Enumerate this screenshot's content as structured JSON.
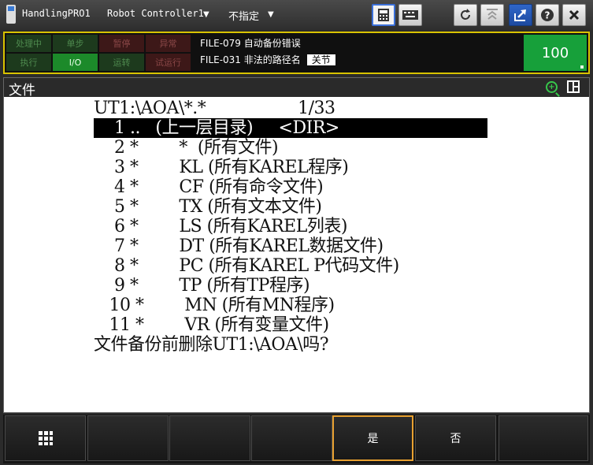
{
  "titlebar": {
    "program": "HandlingPRO1",
    "controller": "Robot Controller1",
    "group": "不指定"
  },
  "status": {
    "indicators": [
      "处理中",
      "单步",
      "暂停",
      "异常",
      "执行",
      "I/O",
      "运转",
      "试运行"
    ],
    "messages": [
      "FILE-079 自动备份错误",
      "FILE-031 非法的路径名"
    ],
    "message_key": "关节",
    "override": "100"
  },
  "panel": {
    "title": "文件",
    "lines": [
      {
        "text": "UT1:\\AOA\\*.*                  1/33",
        "selected": false
      },
      {
        "text": "    1 ..   (上一层目录)     <DIR>    ",
        "selected": true
      },
      {
        "text": "    2 *        *  (所有文件)",
        "selected": false
      },
      {
        "text": "    3 *        KL (所有KAREL程序)",
        "selected": false
      },
      {
        "text": "    4 *        CF (所有命令文件)",
        "selected": false
      },
      {
        "text": "    5 *        TX (所有文本文件)",
        "selected": false
      },
      {
        "text": "    6 *        LS (所有KAREL列表)",
        "selected": false
      },
      {
        "text": "    7 *        DT (所有KAREL数据文件)",
        "selected": false
      },
      {
        "text": "    8 *        PC (所有KAREL P代码文件)",
        "selected": false
      },
      {
        "text": "    9 *        TP (所有TP程序)",
        "selected": false
      },
      {
        "text": "   10 *        MN (所有MN程序)",
        "selected": false
      },
      {
        "text": "   11 *        VR (所有变量文件)",
        "selected": false
      },
      {
        "text": "文件备份前删除UT1:\\AOA\\吗?",
        "selected": false
      }
    ]
  },
  "softkeys": [
    "",
    "",
    "",
    "",
    "是",
    "否",
    ""
  ],
  "colors": {
    "selection_bg": "#000000",
    "override_bg": "#17a03a",
    "status_border": "#d8c300",
    "active_key_border": "#e8a030"
  }
}
